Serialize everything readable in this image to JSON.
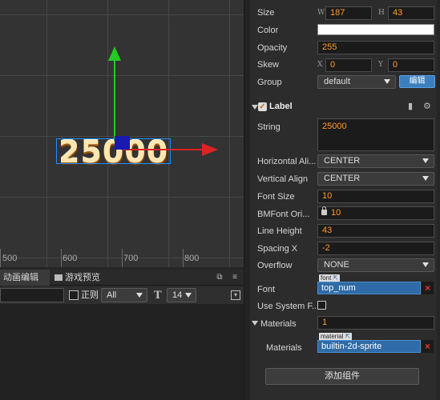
{
  "scene": {
    "ruler_labels": [
      "500",
      "600",
      "700",
      "800"
    ],
    "label_text": "25000"
  },
  "bottom_panel": {
    "tabs": [
      "动画编辑器",
      "游戏预览"
    ],
    "toolbar": {
      "regex_label": "正则",
      "level_select": "All",
      "font_icon": "T",
      "font_size": "14"
    }
  },
  "inspector": {
    "size": {
      "label": "Size",
      "w_tag": "W",
      "w": "187",
      "h_tag": "H",
      "h": "43"
    },
    "color": {
      "label": "Color",
      "value": "#ffffff"
    },
    "opacity": {
      "label": "Opacity",
      "value": "255"
    },
    "skew": {
      "label": "Skew",
      "x_tag": "X",
      "x": "0",
      "y_tag": "Y",
      "y": "0"
    },
    "group": {
      "label": "Group",
      "value": "default",
      "edit_button": "编辑"
    },
    "label_component": {
      "title": "Label",
      "string": {
        "label": "String",
        "value": "25000"
      },
      "horizontal_align": {
        "label": "Horizontal Ali...",
        "value": "CENTER"
      },
      "vertical_align": {
        "label": "Vertical Align",
        "value": "CENTER"
      },
      "font_size": {
        "label": "Font Size",
        "value": "10"
      },
      "bmfont_original_size": {
        "label": "BMFont Ori...",
        "value": "10"
      },
      "line_height": {
        "label": "Line Height",
        "value": "43"
      },
      "spacing_x": {
        "label": "Spacing X",
        "value": "-2"
      },
      "overflow": {
        "label": "Overflow",
        "value": "NONE"
      },
      "font": {
        "label": "Font",
        "tag": "font",
        "value": "top_num"
      },
      "use_system_font": {
        "label": "Use System F...",
        "checked": false
      },
      "materials": {
        "label": "Materials",
        "count": "1",
        "item_label": "Materials",
        "tag": "material",
        "value": "builtin-2d-sprite"
      }
    },
    "add_component_button": "添加组件"
  },
  "colors": {
    "accent_blue": "#3b7fbf",
    "field_value": "#ff9a2e",
    "axis_x": "#dd2222",
    "axis_y": "#22cc22"
  }
}
